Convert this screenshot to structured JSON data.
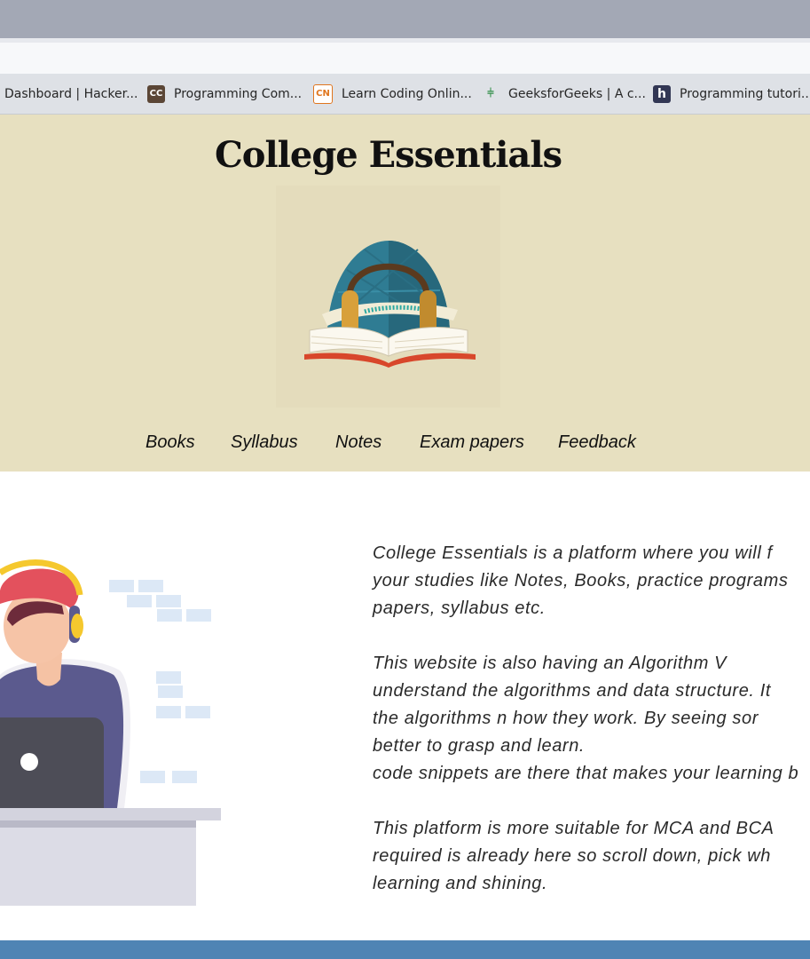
{
  "bookmarks": [
    {
      "label": "Dashboard | Hacker...",
      "icon": "hackerrank-icon"
    },
    {
      "label": "Programming Com...",
      "icon": "codechef-icon"
    },
    {
      "label": "Learn Coding Onlin...",
      "icon": "coding-ninjas-icon"
    },
    {
      "label": "GeeksforGeeks | A c...",
      "icon": "geeksforgeeks-icon"
    },
    {
      "label": "Programming tutori...",
      "icon": "hackerearth-icon"
    }
  ],
  "site": {
    "title": "College Essentials"
  },
  "nav": [
    {
      "label": "Books"
    },
    {
      "label": "Syllabus"
    },
    {
      "label": "Notes"
    },
    {
      "label": "Exam papers"
    },
    {
      "label": "Feedback"
    }
  ],
  "about": {
    "lines": [
      "College Essentials is a platform where you will f",
      "your studies like Notes, Books, practice programs",
      "papers, syllabus etc.",
      "This website is also having an Algorithm V",
      "understand the algorithms and data structure. It",
      "the algorithms n how they work. By seeing sor",
      "better to grasp and learn.",
      "code snippets are there that makes your learning b",
      "This platform is more suitable for MCA and BCA",
      "required is already here so scroll down, pick wh",
      "learning and shining."
    ]
  },
  "colors": {
    "hero_bg": "#e7e0c0",
    "footer_bar": "#4f84b4",
    "browser_chrome": "#a3a8b5"
  }
}
